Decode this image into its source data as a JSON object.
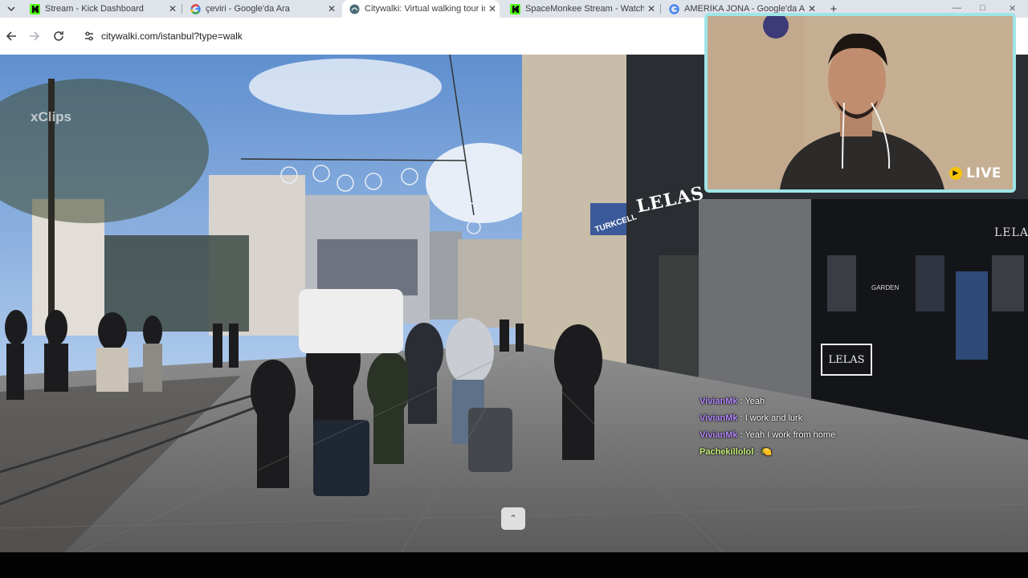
{
  "browser": {
    "tabs": [
      {
        "title": "Stream - Kick Dashboard",
        "favicon": "kick-icon",
        "active": false
      },
      {
        "title": "çeviri - Google'da Ara",
        "favicon": "google-icon",
        "active": false
      },
      {
        "title": "Citywalki: Virtual walking tour in",
        "favicon": "citywalki-icon",
        "active": true
      },
      {
        "title": "SpaceMonkee Stream - Watch L",
        "favicon": "kick-icon",
        "active": false
      },
      {
        "title": "AMERİKA JONA - Google'da A",
        "favicon": "google-icon",
        "active": false
      }
    ],
    "close_glyph": "✕",
    "new_tab_glyph": "+",
    "url": "citywalki.com/istanbul?type=walk"
  },
  "video": {
    "watermark": "xClips",
    "shop_sign": "LELAS",
    "shop_sign_small": "LELAS",
    "shop_sign_box": "LELAS",
    "sign_blue": "TURKCELL",
    "sign_garden": "GARDEN"
  },
  "overlay": {
    "live_label": "LIVE",
    "chat": [
      {
        "user": "VivianMk",
        "message": "Yeah",
        "color": "purple"
      },
      {
        "user": "VivianMk",
        "message": "I work and lurk",
        "color": "purple"
      },
      {
        "user": "VivianMk",
        "message": "Yeah I work from home",
        "color": "purple"
      },
      {
        "user": "Pachekillolol",
        "message": "🍋",
        "color": "green"
      }
    ],
    "chat_separator": ":"
  },
  "scroll_up_glyph": "⌃",
  "colors": {
    "cam_border": "#9ee5e8",
    "chat_user_purple": "#b68bff",
    "chat_user_green": "#c9f07a",
    "live_badge": "#f6c400"
  }
}
